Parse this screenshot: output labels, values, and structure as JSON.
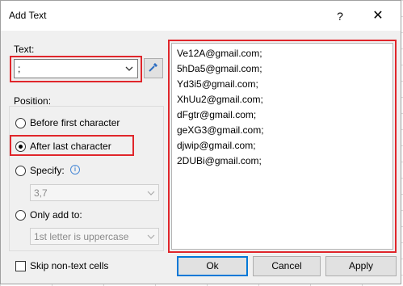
{
  "window": {
    "title": "Add Text",
    "help_label": "?",
    "close_label": "✕"
  },
  "text_field": {
    "label": "Text:",
    "value": ";",
    "picker_icon": "eyedropper-icon"
  },
  "position": {
    "label": "Position:",
    "options": [
      {
        "label": "Before first character",
        "checked": false
      },
      {
        "label": "After last character",
        "checked": true
      },
      {
        "label": "Specify:",
        "checked": false
      },
      {
        "label": "Only add to:",
        "checked": false
      }
    ],
    "specify_value": "3,7",
    "only_add_value": "1st letter is uppercase"
  },
  "preview": {
    "lines": [
      "Ve12A@gmail.com;",
      "5hDa5@gmail.com;",
      "Yd3i5@gmail.com;",
      "XhUu2@gmail.com;",
      "dFgtr@gmail.com;",
      "geXG3@gmail.com;",
      "djwip@gmail.com;",
      "2DUBi@gmail.com;"
    ]
  },
  "footer": {
    "skip_label": "Skip non-text cells",
    "ok_label": "Ok",
    "cancel_label": "Cancel",
    "apply_label": "Apply"
  },
  "colors": {
    "highlight": "#e0262b",
    "default_button_border": "#0078d7"
  }
}
